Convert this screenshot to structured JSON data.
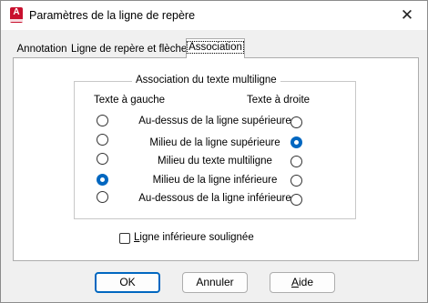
{
  "window": {
    "title": "Paramètres de la ligne de repère"
  },
  "app_icon": {
    "letter": "A"
  },
  "tabs": [
    {
      "label": "Annotation",
      "active": false
    },
    {
      "label": "Ligne de repère et flèche",
      "active": false
    },
    {
      "label": "Association",
      "active": true
    }
  ],
  "association_group": {
    "title": "Association du texte multiligne",
    "left_header": "Texte à gauche",
    "right_header": "Texte à droite",
    "rows": [
      {
        "label": "Au-dessus de la ligne supérieure",
        "left_checked": false,
        "right_checked": false
      },
      {
        "label": "Milieu de la ligne supérieure",
        "left_checked": false,
        "right_checked": true
      },
      {
        "label": "Milieu du texte multiligne",
        "left_checked": false,
        "right_checked": false
      },
      {
        "label": "Milieu de la ligne inférieure",
        "left_checked": true,
        "right_checked": false
      },
      {
        "label": "Au-dessous de la ligne inférieure",
        "left_checked": false,
        "right_checked": false
      }
    ]
  },
  "underline_option": {
    "label_prefix": "L",
    "label_rest": "igne inférieure soulignée",
    "checked": false
  },
  "buttons": {
    "ok": "OK",
    "cancel": "Annuler",
    "help_prefix": "A",
    "help_rest": "ide"
  },
  "colors": {
    "accent": "#0067c0",
    "app_icon": "#c8102e"
  }
}
